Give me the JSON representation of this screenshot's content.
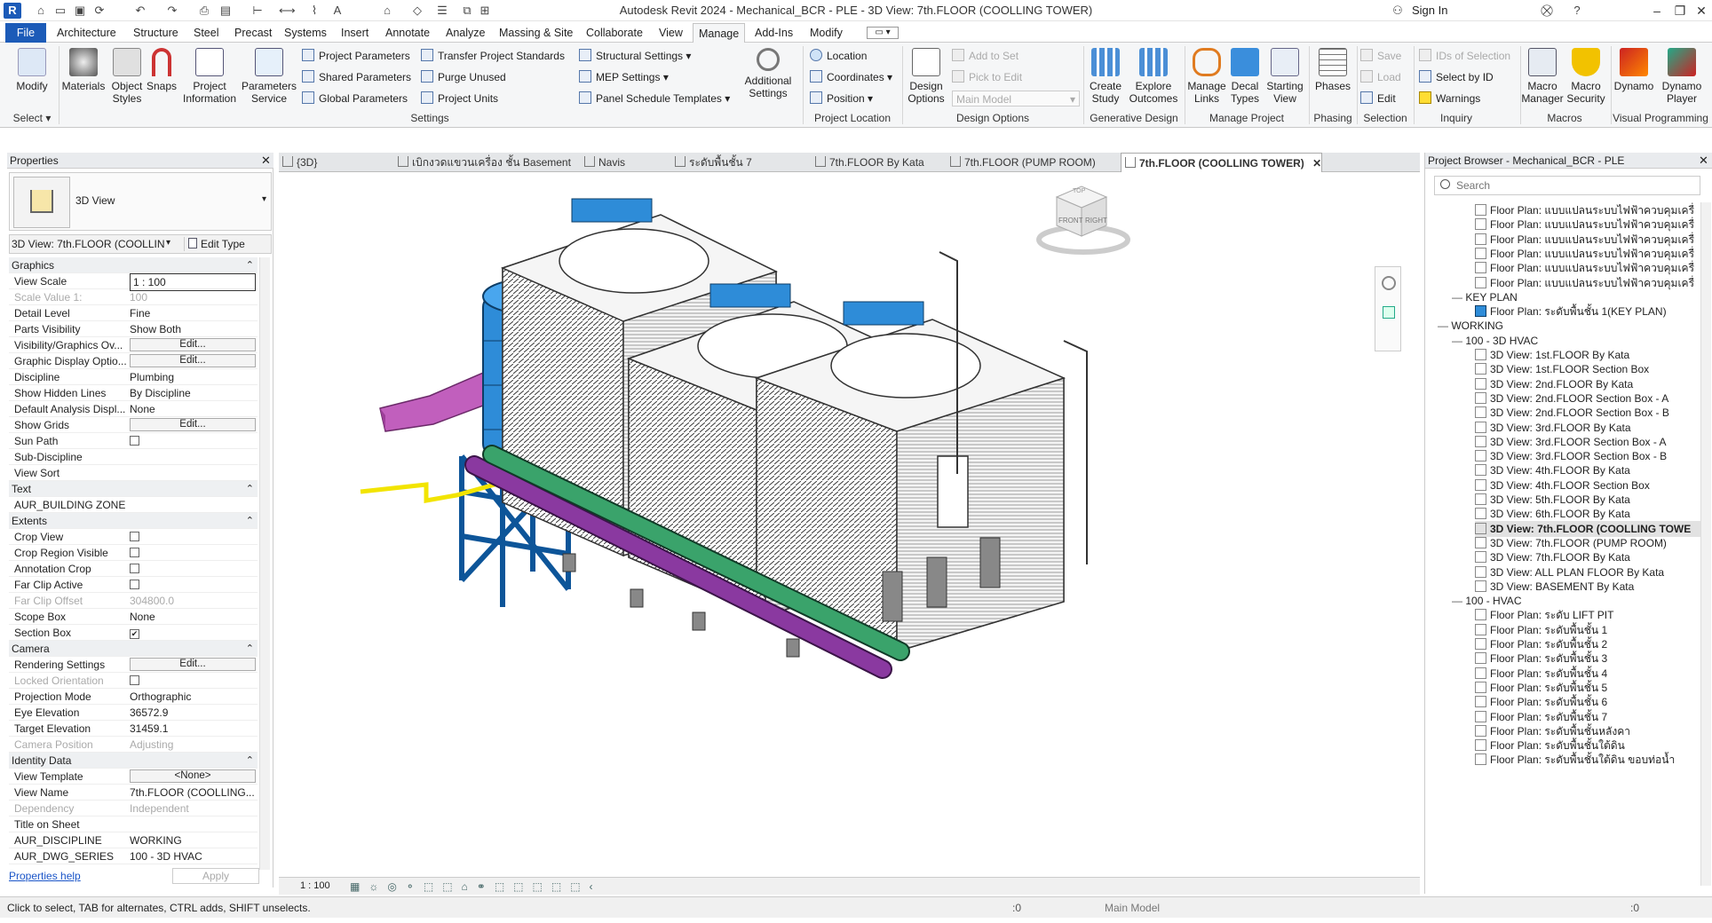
{
  "app": {
    "title": "Autodesk Revit 2024 - Mechanical_BCR - PLE - 3D View: 7th.FLOOR (COOLLING TOWER)",
    "logo_letter": "R",
    "sign_in": "Sign In"
  },
  "menu": {
    "file": "File",
    "tabs": [
      "Architecture",
      "Structure",
      "Steel",
      "Precast",
      "Systems",
      "Insert",
      "Annotate",
      "Analyze",
      "Massing & Site",
      "Collaborate",
      "View",
      "Manage",
      "Add-Ins",
      "Modify"
    ],
    "active": "Manage"
  },
  "ribbon": {
    "select": {
      "modify": "Modify",
      "panel": "Select ▾"
    },
    "settings": {
      "materials": "Materials",
      "object_styles": "Object Styles",
      "snaps": "Snaps",
      "project_information": "Project Information",
      "parameters_service": "Parameters Service",
      "project_parameters": "Project Parameters",
      "shared_parameters": "Shared Parameters",
      "global_parameters": "Global Parameters",
      "transfer_standards": "Transfer Project Standards",
      "purge_unused": "Purge Unused",
      "project_units": "Project Units",
      "structural_settings": "Structural Settings ▾",
      "mep_settings": "MEP Settings ▾",
      "panel_schedule_templates": "Panel Schedule Templates ▾",
      "additional_settings": "Additional Settings",
      "panel": "Settings"
    },
    "project_location": {
      "location": "Location",
      "coordinates": "Coordinates ▾",
      "position": "Position ▾",
      "panel": "Project Location"
    },
    "design_options": {
      "design_options": "Design Options",
      "add_to_set": "Add to Set",
      "pick_to_edit": "Pick to Edit",
      "main_model": "Main Model",
      "panel": "Design Options"
    },
    "generative": {
      "create_study": "Create Study",
      "explore_outcomes": "Explore Outcomes",
      "panel": "Generative Design"
    },
    "manage_project": {
      "manage_links": "Manage Links",
      "decal_types": "Decal Types",
      "starting_view": "Starting View",
      "panel": "Manage Project"
    },
    "phasing": {
      "phases": "Phases",
      "panel": "Phasing"
    },
    "selection": {
      "save": "Save",
      "load": "Load",
      "edit": "Edit",
      "panel": "Selection"
    },
    "inquiry": {
      "ids_of_selection": "IDs of Selection",
      "select_by_id": "Select by ID",
      "warnings": "Warnings",
      "panel": "Inquiry"
    },
    "macros": {
      "macro_manager": "Macro Manager",
      "macro_security": "Macro Security",
      "panel": "Macros"
    },
    "visual_programming": {
      "dynamo": "Dynamo",
      "dynamo_player": "Dynamo Player",
      "panel": "Visual Programming"
    }
  },
  "view_tabs": [
    {
      "label": "{3D}",
      "active": false
    },
    {
      "label": "เบิกงวดแขวนเครื่อง ชั้น Basement",
      "active": false
    },
    {
      "label": "Navis",
      "active": false
    },
    {
      "label": "ระดับพื้นชั้น 7",
      "active": false
    },
    {
      "label": "7th.FLOOR By Kata",
      "active": false
    },
    {
      "label": "7th.FLOOR (PUMP ROOM)",
      "active": false
    },
    {
      "label": "7th.FLOOR (COOLLING TOWER)",
      "active": true
    }
  ],
  "properties": {
    "title": "Properties",
    "type_name": "3D View",
    "instance": "3D View: 7th.FLOOR (COOLLING TOV",
    "edit_type": "Edit Type",
    "help": "Properties help",
    "apply": "Apply",
    "rows": [
      {
        "g": true,
        "n": "Graphics"
      },
      {
        "n": "View Scale",
        "v": "1 : 100",
        "kind": "input"
      },
      {
        "n": "Scale Value    1:",
        "v": "100",
        "dis": true
      },
      {
        "n": "Detail Level",
        "v": "Fine"
      },
      {
        "n": "Parts Visibility",
        "v": "Show Both"
      },
      {
        "n": "Visibility/Graphics Ov...",
        "v": "Edit...",
        "kind": "btn"
      },
      {
        "n": "Graphic Display Optio...",
        "v": "Edit...",
        "kind": "btn"
      },
      {
        "n": "Discipline",
        "v": "Plumbing"
      },
      {
        "n": "Show Hidden Lines",
        "v": "By Discipline"
      },
      {
        "n": "Default Analysis Displ...",
        "v": "None"
      },
      {
        "n": "Show Grids",
        "v": "Edit...",
        "kind": "btn"
      },
      {
        "n": "Sun Path",
        "v": "",
        "kind": "chk"
      },
      {
        "n": "Sub-Discipline",
        "v": ""
      },
      {
        "n": "View Sort",
        "v": ""
      },
      {
        "g": true,
        "n": "Text"
      },
      {
        "n": "AUR_BUILDING ZONE",
        "v": ""
      },
      {
        "g": true,
        "n": "Extents"
      },
      {
        "n": "Crop View",
        "v": "",
        "kind": "chk"
      },
      {
        "n": "Crop Region Visible",
        "v": "",
        "kind": "chk"
      },
      {
        "n": "Annotation Crop",
        "v": "",
        "kind": "chk"
      },
      {
        "n": "Far Clip Active",
        "v": "",
        "kind": "chk"
      },
      {
        "n": "Far Clip Offset",
        "v": "304800.0",
        "dis": true
      },
      {
        "n": "Scope Box",
        "v": "None"
      },
      {
        "n": "Section Box",
        "v": "✔",
        "kind": "chk"
      },
      {
        "g": true,
        "n": "Camera"
      },
      {
        "n": "Rendering Settings",
        "v": "Edit...",
        "kind": "btn"
      },
      {
        "n": "Locked Orientation",
        "v": "",
        "kind": "chk",
        "dis": true
      },
      {
        "n": "Projection Mode",
        "v": "Orthographic"
      },
      {
        "n": "Eye Elevation",
        "v": "36572.9"
      },
      {
        "n": "Target Elevation",
        "v": "31459.1"
      },
      {
        "n": "Camera Position",
        "v": "Adjusting",
        "dis": true
      },
      {
        "g": true,
        "n": "Identity Data"
      },
      {
        "n": "View Template",
        "v": "<None>",
        "kind": "btn"
      },
      {
        "n": "View Name",
        "v": "7th.FLOOR (COOLLING..."
      },
      {
        "n": "Dependency",
        "v": "Independent",
        "dis": true
      },
      {
        "n": "Title on Sheet",
        "v": ""
      },
      {
        "n": "AUR_DISCIPLINE",
        "v": "WORKING"
      },
      {
        "n": "AUR_DWG_SERIES",
        "v": "100 - 3D HVAC"
      }
    ]
  },
  "browser": {
    "title": "Project Browser - Mechanical_BCR - PLE",
    "search_placeholder": "Search",
    "rows": [
      {
        "t": "Floor Plan: แบบแปลนระบบไฟฟ้าควบคุมเครื่",
        "d": 3
      },
      {
        "t": "Floor Plan: แบบแปลนระบบไฟฟ้าควบคุมเครื่",
        "d": 3
      },
      {
        "t": "Floor Plan: แบบแปลนระบบไฟฟ้าควบคุมเครื่",
        "d": 3
      },
      {
        "t": "Floor Plan: แบบแปลนระบบไฟฟ้าควบคุมเครื่",
        "d": 3
      },
      {
        "t": "Floor Plan: แบบแปลนระบบไฟฟ้าควบคุมเครื่",
        "d": 3
      },
      {
        "t": "Floor Plan: แบบแปลนระบบไฟฟ้าควบคุมเครื่",
        "d": 3
      },
      {
        "t": "KEY PLAN",
        "d": 2,
        "h": true
      },
      {
        "t": "Floor Plan: ระดับพื้นชั้น 1(KEY PLAN)",
        "d": 3,
        "blue": true
      },
      {
        "t": "WORKING",
        "d": 1,
        "h": true
      },
      {
        "t": "100 - 3D HVAC",
        "d": 2,
        "h": true
      },
      {
        "t": "3D View: 1st.FLOOR By Kata",
        "d": 3
      },
      {
        "t": "3D View: 1st.FLOOR Section Box",
        "d": 3
      },
      {
        "t": "3D View: 2nd.FLOOR By Kata",
        "d": 3
      },
      {
        "t": "3D View: 2nd.FLOOR Section Box - A",
        "d": 3
      },
      {
        "t": "3D View: 2nd.FLOOR Section Box - B",
        "d": 3
      },
      {
        "t": "3D View: 3rd.FLOOR By Kata",
        "d": 3
      },
      {
        "t": "3D View: 3rd.FLOOR Section Box - A",
        "d": 3
      },
      {
        "t": "3D View: 3rd.FLOOR Section Box - B",
        "d": 3
      },
      {
        "t": "3D View: 4th.FLOOR By Kata",
        "d": 3
      },
      {
        "t": "3D View: 4th.FLOOR Section Box",
        "d": 3
      },
      {
        "t": "3D View: 5th.FLOOR By Kata",
        "d": 3
      },
      {
        "t": "3D View: 6th.FLOOR By Kata",
        "d": 3
      },
      {
        "t": "3D View: 7th.FLOOR (COOLLING TOWE",
        "d": 3,
        "sel": true
      },
      {
        "t": "3D View: 7th.FLOOR (PUMP ROOM)",
        "d": 3
      },
      {
        "t": "3D View: 7th.FLOOR By Kata",
        "d": 3
      },
      {
        "t": "3D View: ALL PLAN FLOOR By Kata",
        "d": 3
      },
      {
        "t": "3D View: BASEMENT By Kata",
        "d": 3
      },
      {
        "t": "100 - HVAC",
        "d": 2,
        "h": true
      },
      {
        "t": "Floor Plan: ระดับ LIFT PIT",
        "d": 3
      },
      {
        "t": "Floor Plan: ระดับพื้นชั้น 1",
        "d": 3
      },
      {
        "t": "Floor Plan: ระดับพื้นชั้น 2",
        "d": 3
      },
      {
        "t": "Floor Plan: ระดับพื้นชั้น 3",
        "d": 3
      },
      {
        "t": "Floor Plan: ระดับพื้นชั้น 4",
        "d": 3
      },
      {
        "t": "Floor Plan: ระดับพื้นชั้น 5",
        "d": 3
      },
      {
        "t": "Floor Plan: ระดับพื้นชั้น 6",
        "d": 3
      },
      {
        "t": "Floor Plan: ระดับพื้นชั้น 7",
        "d": 3
      },
      {
        "t": "Floor Plan: ระดับพื้นชั้นหลังคา",
        "d": 3
      },
      {
        "t": "Floor Plan: ระดับพื้นชั้นใต้ดิน",
        "d": 3
      },
      {
        "t": "Floor Plan: ระดับพื้นชั้นใต้ดิน ขอบท่อน้ำ",
        "d": 3
      }
    ]
  },
  "viewcube": {
    "top": "TOP",
    "front": "FRONT",
    "right": "RIGHT"
  },
  "view_control": {
    "scale": "1 : 100"
  },
  "status": {
    "hint": "Click to select, TAB for alternates, CTRL adds, SHIFT unselects.",
    "worksets": ":0",
    "model": "Main Model",
    "filter": ":0"
  }
}
